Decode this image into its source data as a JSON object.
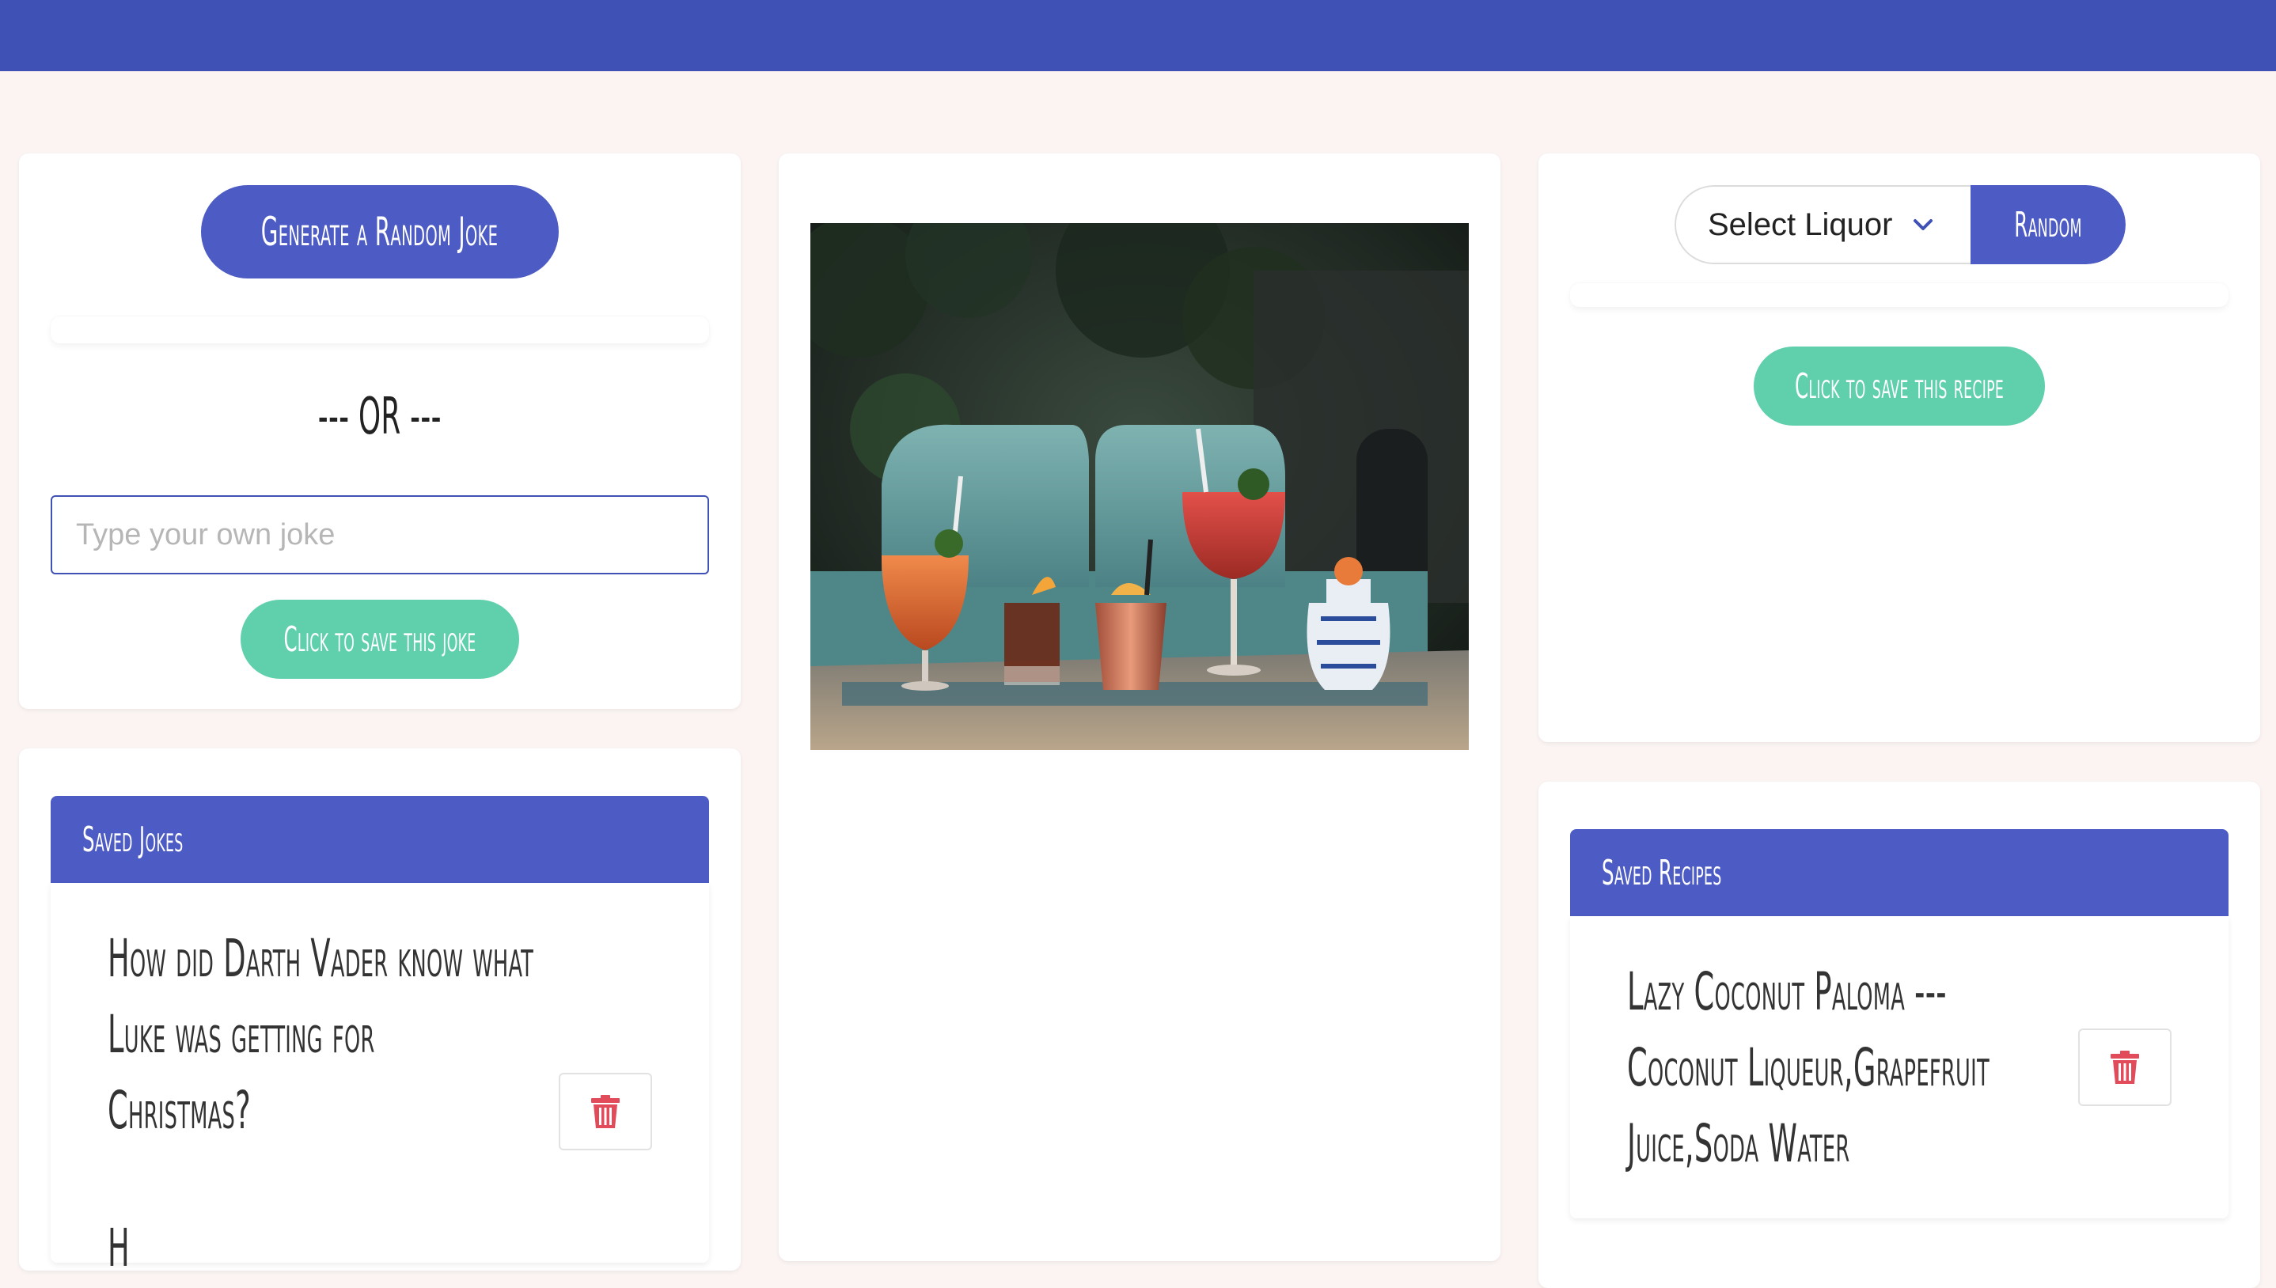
{
  "joke_card": {
    "generate_button_label": "Generate a Random Joke",
    "or_text": "--- OR ---",
    "input_placeholder": "Type your own joke",
    "input_value": "",
    "save_button_label": "Click to save this joke"
  },
  "image": {
    "description_icon": "cocktails-photo"
  },
  "recipe_card": {
    "select_label": "Select Liquor",
    "random_button_label": "Random",
    "save_button_label": "Click to save this recipe"
  },
  "saved_jokes": {
    "header": "Saved Jokes",
    "items": [
      {
        "lines": [
          "How did Darth Vader know what",
          "Luke was getting for",
          "Christmas?"
        ]
      }
    ],
    "next_item_fragment": "H"
  },
  "saved_recipes": {
    "header": "Saved Recipes",
    "items": [
      {
        "lines": [
          "Lazy Coconut Paloma ---",
          "Coconut Liqueur,Grapefruit",
          "Juice,Soda Water"
        ]
      }
    ]
  },
  "colors": {
    "navbar": "#3f51b5",
    "primary_button": "#4d5bc4",
    "teal_button": "#5fcfac",
    "trash_icon": "#e14b5a",
    "page_background": "#fbf4f3"
  }
}
